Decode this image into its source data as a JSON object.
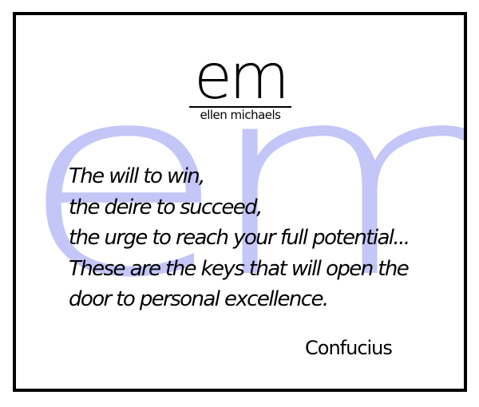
{
  "watermark": {
    "text": "em",
    "color": "#c3c6f7"
  },
  "logo": {
    "mark": "em",
    "name": "ellen michaels"
  },
  "quote": {
    "lines": [
      "The will to win,",
      "the deire to succeed,",
      "the urge to reach your full potential...",
      "These are the keys that will open the",
      "door to personal excellence."
    ],
    "author": "Confucius"
  }
}
